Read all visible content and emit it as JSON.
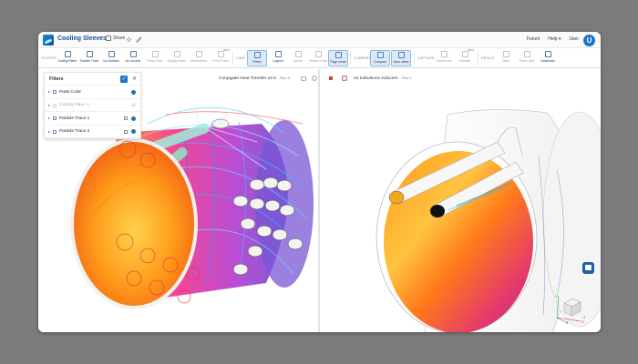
{
  "header": {
    "project_title": "Cooling Sleeves",
    "share_label": "Share",
    "links": [
      "Forum",
      "Help ▾",
      "User"
    ],
    "avatar_initial": "U"
  },
  "ribbon": {
    "groups": {
      "filters": "FILTERS",
      "view": "VIEW",
      "compare": "COMPARE",
      "capture": "CAPTURE",
      "result": "RESULT"
    },
    "beta": "BETA",
    "buttons": {
      "cutting_plane": "Cutting Plane",
      "particle_trace": "Particle Trace",
      "iso_surface": "Iso Surface",
      "iso_volume": "Iso Volume",
      "parts_color": "Parts Color",
      "deformation": "Displacement",
      "streamlines": "Streamlines",
      "point_probe": "Point Probe",
      "filters": "Filters",
      "legend": "Legend",
      "outline": "Outline",
      "feature_edge": "Feature Edge",
      "page_mode": "Page mode",
      "compare": "Compare",
      "sync_views": "Sync views",
      "screenshot": "Screenshot",
      "animate": "Animate",
      "table": "Table",
      "share_view": "Share view",
      "download": "Download"
    }
  },
  "viewports": {
    "left_sim": "Conjugate Heat Transfer v2.0",
    "left_run": "- Run 3",
    "right_sim": "no turbulence inducers",
    "right_run": "- Run 1"
  },
  "filters_panel": {
    "title": "Filters",
    "items": [
      {
        "label": "Parts Color",
        "enabled": true
      },
      {
        "label": "Cutting Plane 1",
        "enabled": false
      },
      {
        "label": "Particle Trace 1",
        "enabled": true
      },
      {
        "label": "Particle Trace 2",
        "enabled": true
      }
    ]
  },
  "view_cube": {
    "axis_x": "X",
    "axis_y": "Y",
    "axis_z": "Z",
    "axis_2": "2"
  },
  "colors": {
    "accent": "#1a74c9",
    "brand": "#1e4f96",
    "backdrop": "#7b7b7b"
  }
}
